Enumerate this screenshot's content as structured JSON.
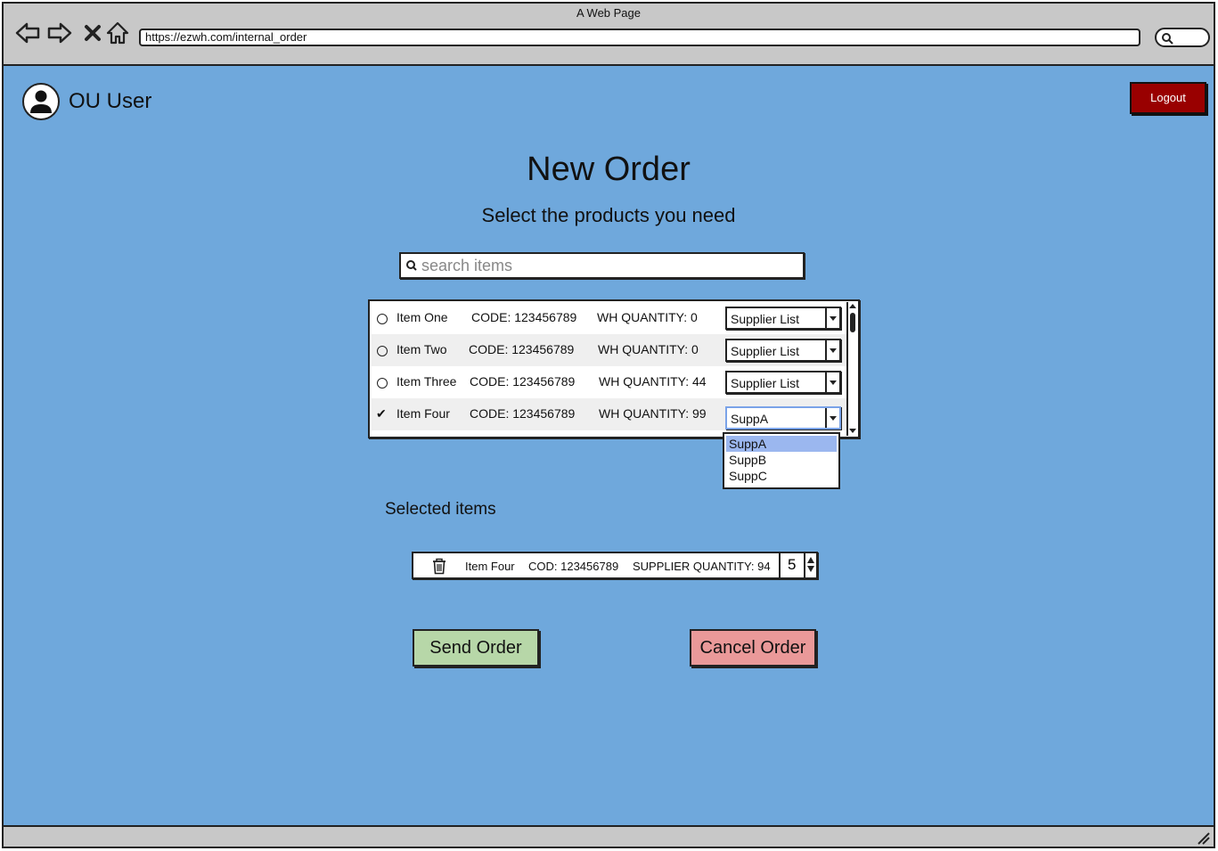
{
  "window": {
    "title": "A Web Page",
    "url": "https://ezwh.com/internal_order"
  },
  "header": {
    "user_name": "OU User",
    "logout_label": "Logout"
  },
  "page": {
    "title": "New Order",
    "subtitle": "Select the products you need"
  },
  "search": {
    "placeholder": "search items"
  },
  "items": [
    {
      "name": "Item One",
      "code": "CODE: 123456789",
      "wh_quantity": "WH QUANTITY: 0",
      "selected": false,
      "supplier": "Supplier List"
    },
    {
      "name": "Item Two",
      "code": "CODE: 123456789",
      "wh_quantity": "WH QUANTITY: 0",
      "selected": false,
      "supplier": "Supplier List"
    },
    {
      "name": "Item Three",
      "code": "CODE: 123456789",
      "wh_quantity": "WH QUANTITY: 44",
      "selected": false,
      "supplier": "Supplier List"
    },
    {
      "name": "Item Four",
      "code": "CODE: 123456789",
      "wh_quantity": "WH QUANTITY: 99",
      "selected": true,
      "supplier": "SuppA"
    }
  ],
  "supplier_options": [
    "SuppA",
    "SuppB",
    "SuppC"
  ],
  "selected_section": {
    "label": "Selected items",
    "rows": [
      {
        "name": "Item Four",
        "code": "COD: 123456789",
        "supplier_quantity": "SUPPLIER QUANTITY: 94",
        "order_quantity": "5"
      }
    ]
  },
  "actions": {
    "send_label": "Send Order",
    "cancel_label": "Cancel Order"
  },
  "colors": {
    "background": "#6fa8dc",
    "logout": "#990000",
    "send": "#b7d7a8",
    "cancel": "#ea9999",
    "highlight": "#9bb7ef"
  }
}
